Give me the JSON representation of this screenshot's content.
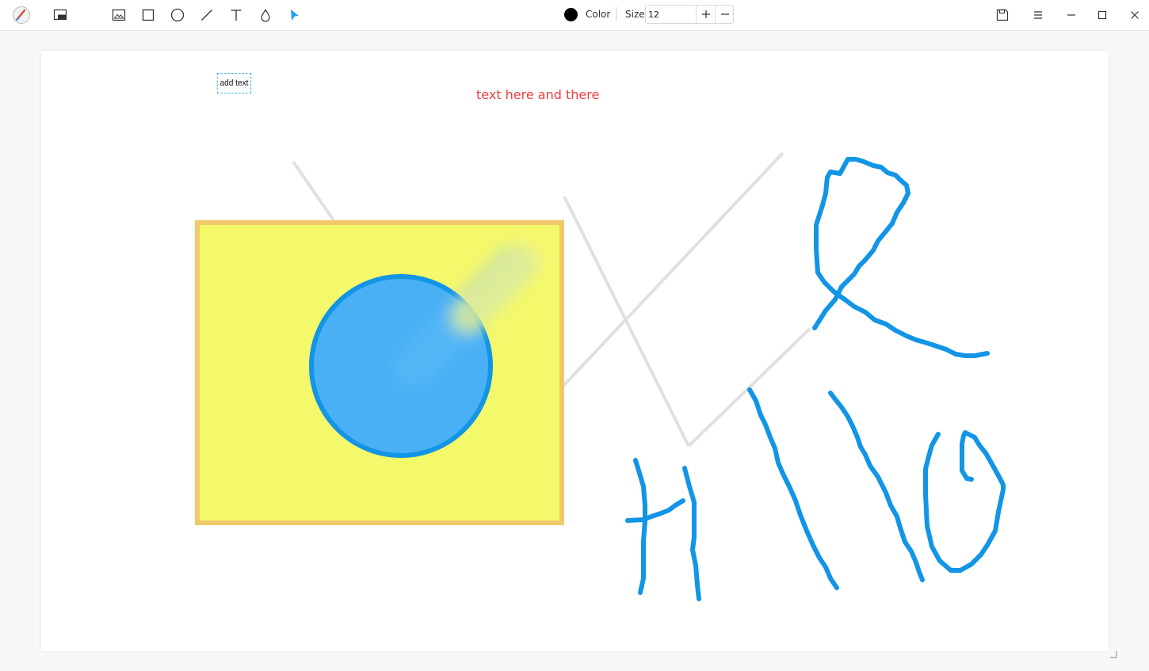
{
  "toolbar": {
    "tools": [
      {
        "name": "app-logo"
      },
      {
        "name": "crop-tool"
      },
      {
        "name": "image-tool"
      },
      {
        "name": "rectangle-tool"
      },
      {
        "name": "ellipse-tool"
      },
      {
        "name": "line-tool"
      },
      {
        "name": "text-tool"
      },
      {
        "name": "blur-tool"
      },
      {
        "name": "selection-tool"
      }
    ],
    "color_label": "Color",
    "color_value": "#000000",
    "size_label": "Size",
    "size_value": "12"
  },
  "canvas": {
    "text_items": {
      "add_text": "add text",
      "red_text": "text here and there"
    },
    "colors": {
      "rectangle_fill": "#f4f86b",
      "rectangle_stroke": "#f0c96a",
      "circle_fill": "#49b0f5",
      "circle_stroke": "#1295e6",
      "pen_stroke": "#1295e6",
      "line_stroke": "#e0e0e0",
      "red_text": "#e84040"
    }
  }
}
